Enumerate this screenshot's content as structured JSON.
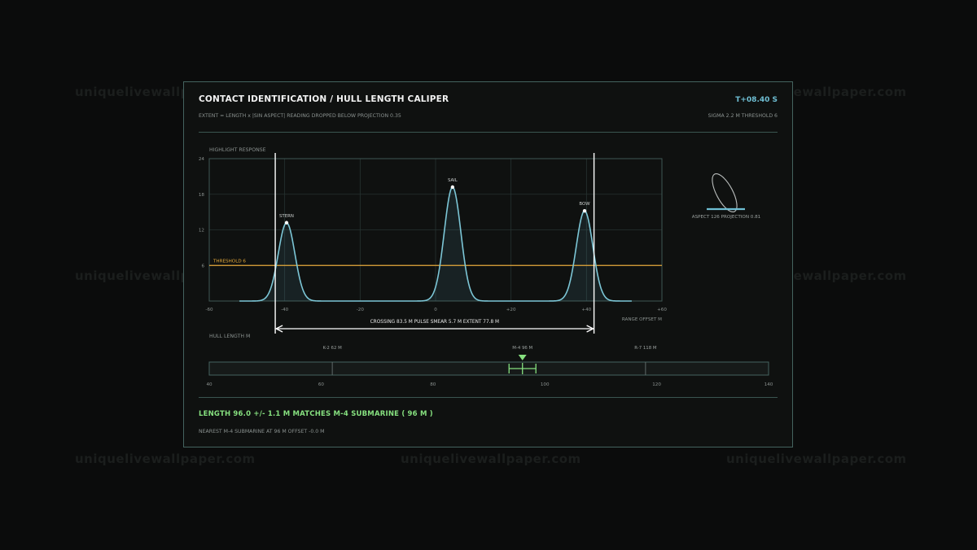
{
  "watermark": "uniquelivewallpaper.com",
  "header": {
    "title": "CONTACT IDENTIFICATION / HULL LENGTH CALIPER",
    "time": "T+08.40 S",
    "subtitle": "EXTENT = LENGTH x |SIN ASPECT|  READING DROPPED BELOW PROJECTION 0.35",
    "params": "SIGMA 2.2 M   THRESHOLD 6"
  },
  "response_chart": {
    "label": "HIGHLIGHT RESPONSE",
    "y_ticks": [
      "24",
      "18",
      "12",
      "6"
    ],
    "x_ticks": [
      "-60",
      "-40",
      "-20",
      "0",
      "+20",
      "+40",
      "+60"
    ],
    "x_axis_label": "RANGE OFFSET M",
    "threshold_label": "THRESHOLD 6",
    "threshold": 6,
    "ylim": [
      0,
      24
    ],
    "xlim": [
      -60,
      60
    ],
    "sigma": 2.2,
    "peaks": [
      {
        "label": "STERN",
        "x": -39.5,
        "y": 13.2
      },
      {
        "label": "SAIL",
        "x": 4.5,
        "y": 19.2
      },
      {
        "label": "BOW",
        "x": 39.5,
        "y": 15.2
      }
    ],
    "caliper": {
      "left": -42.5,
      "right": 42.0
    },
    "readout": "CROSSING 83.5 M   PULSE SMEAR 5.7 M   EXTENT 77.8 M"
  },
  "aspect": {
    "readout": "ASPECT 126   PROJECTION 0.81",
    "accent": "#6fbfd4"
  },
  "hull_scale": {
    "label": "HULL LENGTH M",
    "ticks": [
      "40",
      "60",
      "80",
      "100",
      "120",
      "140"
    ],
    "range": [
      40,
      140
    ],
    "classes": [
      {
        "label": "K-2 62 M",
        "length": 62
      },
      {
        "label": "M-4 96 M",
        "length": 96
      },
      {
        "label": "R-7 118 M",
        "length": 118
      }
    ],
    "measured": 96.0,
    "uncertainty": 1.1
  },
  "result": {
    "headline": "LENGTH 96.0 +/- 1.1 M   MATCHES M-4 SUBMARINE ( 96 M )",
    "nearest": "NEAREST M-4 SUBMARINE AT 96 M   OFFSET -0.0 M"
  },
  "colors": {
    "curve": "#7cc6d6",
    "threshold": "#e5a93a",
    "match": "#86e07f",
    "grid": "#263331",
    "frame": "#44635f"
  }
}
